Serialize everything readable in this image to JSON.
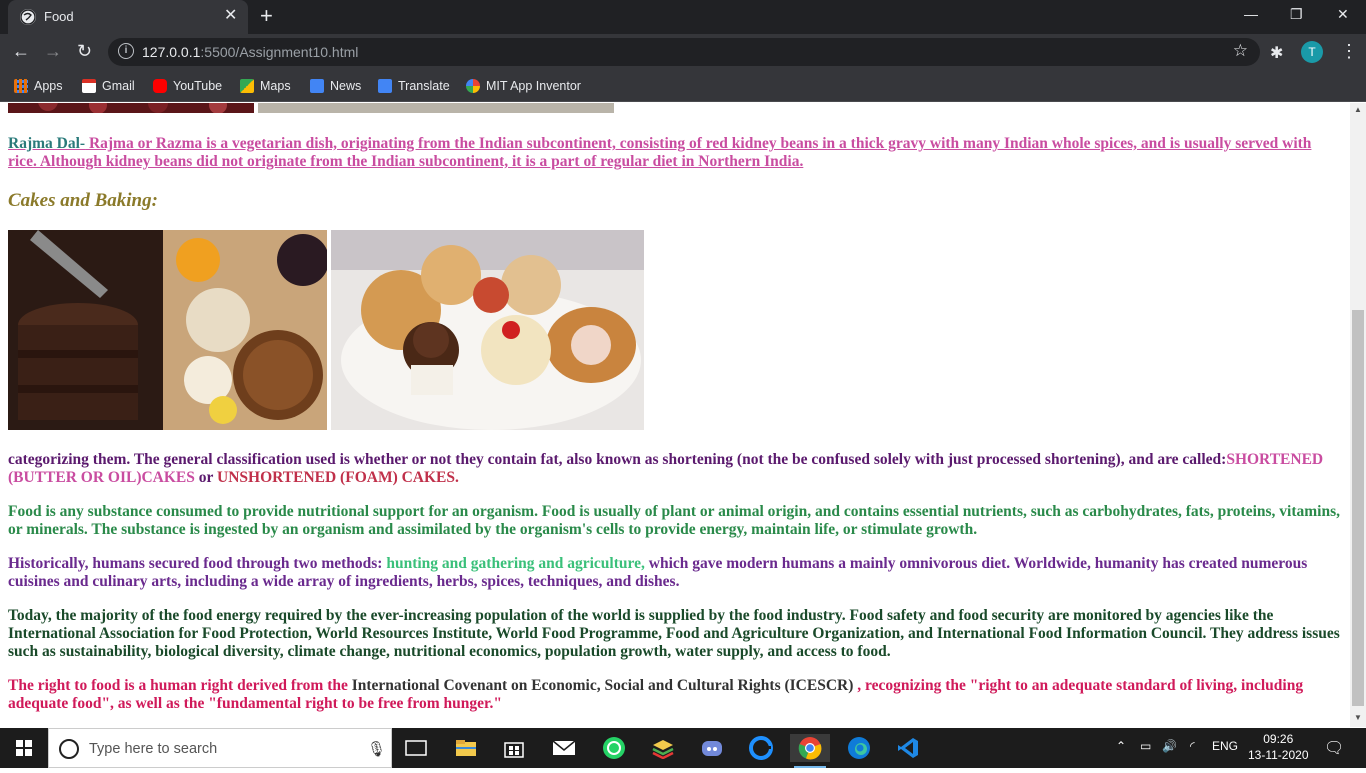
{
  "browser": {
    "tab_title": "Food",
    "tab_close": "✕",
    "new_tab": "+",
    "window_controls": {
      "minimize": "—",
      "restore": "❐",
      "close": "✕"
    },
    "url_host": "127.0.0.1",
    "url_rest": ":5500/Assignment10.html",
    "profile_initial": "T",
    "bookmarks": [
      {
        "label": "Apps",
        "icon": "apps-grid-icon",
        "color": "#e8710a"
      },
      {
        "label": "Gmail",
        "icon": "gmail-icon",
        "color": "#d93025"
      },
      {
        "label": "YouTube",
        "icon": "youtube-icon",
        "color": "#ff0000"
      },
      {
        "label": "Maps",
        "icon": "maps-icon",
        "color": "#34a853"
      },
      {
        "label": "News",
        "icon": "news-icon",
        "color": "#4285f4"
      },
      {
        "label": "Translate",
        "icon": "translate-icon",
        "color": "#4285f4"
      },
      {
        "label": "MIT App Inventor",
        "icon": "google-icon",
        "color": "#ffffff"
      }
    ]
  },
  "content": {
    "rajma_lead": "Rajma Dal-",
    "rajma_text": " Rajma or Razma is a vegetarian dish, originating from the Indian subcontinent, consisting of red kidney beans in a thick gravy with many Indian whole spices, and is usually served with rice. Although kidney beans did not originate from the Indian subcontinent, it is a part of regular diet in Northern India.",
    "cakes_heading": "Cakes and Baking:",
    "categorizing_1": "categorizing them. The general classification used is whether or not they contain fat, also known as shortening (not the be confused solely with just processed shortening), and are called:",
    "categorizing_shortened": "SHORTENED (BUTTER OR OIL)CAKES",
    "categorizing_or": " or ",
    "categorizing_unshortened": "UNSHORTENED (FOAM) CAKES",
    "categorizing_end": ".",
    "food_paragraph": "Food is any substance consumed to provide nutritional support for an organism. Food is usually of plant or animal origin, and contains essential nutrients, such as carbohydrates, fats, proteins, vitamins, or minerals. The substance is ingested by an organism and assimilated by the organism's cells to provide energy, maintain life, or stimulate growth.",
    "hist_1": "Historically, humans secured food through two methods: ",
    "hist_green": "hunting and gathering and agriculture,",
    "hist_2": " which gave modern humans a mainly omnivorous diet. Worldwide, humanity has created numerous cuisines and culinary arts, including a wide array of ingredients, herbs, spices, techniques, and dishes.",
    "today_paragraph": "Today, the majority of the food energy required by the ever-increasing population of the world is supplied by the food industry. Food safety and food security are monitored by agencies like the International Association for Food Protection, World Resources Institute, World Food Programme, Food and Agriculture Organization, and International Food Information Council. They address issues such as sustainability, biological diversity, climate change, nutritional economics, population growth, water supply, and access to food.",
    "right_1": "The right to food is a human right derived from the ",
    "right_dark": "International Covenant on Economic, Social and Cultural Rights (ICESCR)",
    "right_2": " , recognizing the \"right to an adequate standard of living, including adequate food\", as well as the \"fundamental right to be free from hunger.\""
  },
  "taskbar": {
    "search_placeholder": "Type here to search",
    "language": "ENG",
    "time": "09:26",
    "date": "13-11-2020"
  },
  "colors": {
    "rajma_link": "#c94ca0",
    "heading": "#8b7a2a",
    "taskbar": "#1c1c1c"
  }
}
